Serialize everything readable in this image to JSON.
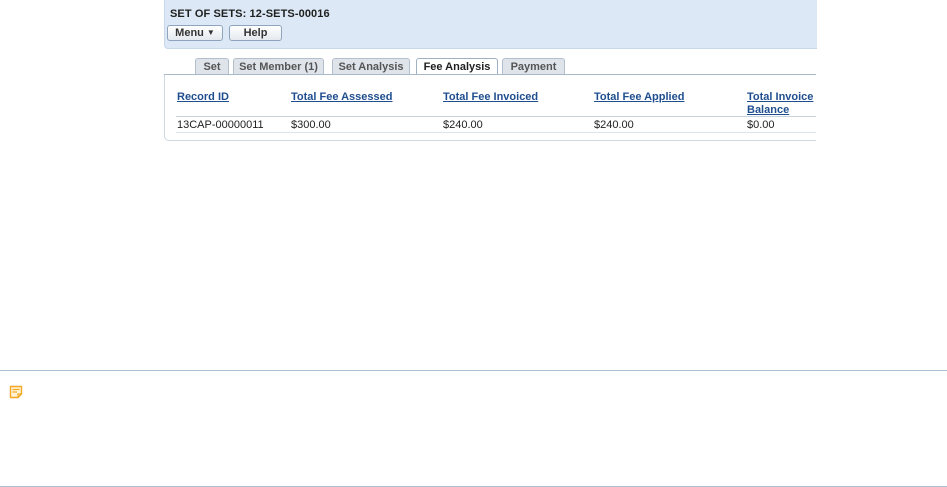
{
  "header": {
    "title": "SET OF SETS: 12-SETS-00016",
    "menu_label": "Menu",
    "menu_caret": "▼",
    "help_label": "Help"
  },
  "tabs": [
    {
      "label": "Set"
    },
    {
      "label": "Set Member (1)"
    },
    {
      "label": "Set Analysis"
    },
    {
      "label": "Fee Analysis",
      "active": true
    },
    {
      "label": "Payment"
    }
  ],
  "table": {
    "columns": [
      "Record ID",
      "Total Fee Assessed",
      "Total Fee Invoiced",
      "Total Fee Applied",
      "Total Invoice Balance"
    ],
    "rows": [
      [
        "13CAP-00000011",
        "$300.00",
        "$240.00",
        "$240.00",
        "$0.00"
      ]
    ]
  },
  "note": {
    "icon": "note-icon",
    "color": "#f5a623"
  }
}
